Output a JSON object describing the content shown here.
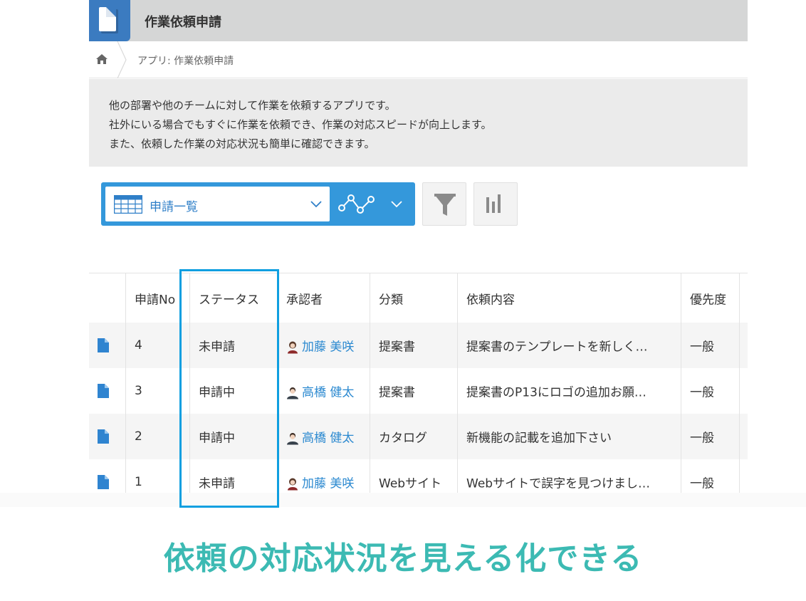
{
  "app": {
    "title": "作業依頼申請",
    "breadcrumb": "アプリ: 作業依頼申請",
    "description": [
      "他の部署や他のチームに対して作業を依頼するアプリです。",
      "社外にいる場合でもすぐに作業を依頼でき、作業の対応スピードが向上します。",
      "また、依頼した作業の対応状況も簡単に確認できます。"
    ]
  },
  "toolbar": {
    "view_label": "申請一覧"
  },
  "table": {
    "headers": [
      "申請No",
      "ステータス",
      "承認者",
      "分類",
      "依頼内容",
      "優先度"
    ],
    "rows": [
      {
        "no": "4",
        "status": "未申請",
        "approver": "加藤 美咲",
        "category": "提案書",
        "content": "提案書のテンプレートを新しく…",
        "priority": "一般"
      },
      {
        "no": "3",
        "status": "申請中",
        "approver": "高橋 健太",
        "category": "提案書",
        "content": "提案書のP13にロゴの追加お願…",
        "priority": "一般"
      },
      {
        "no": "2",
        "status": "申請中",
        "approver": "高橋 健太",
        "category": "カタログ",
        "content": "新機能の記載を追加下さい",
        "priority": "一般"
      },
      {
        "no": "1",
        "status": "未申請",
        "approver": "加藤 美咲",
        "category": "Webサイト",
        "content": "Webサイトで誤字を見つけまし…",
        "priority": "一般"
      }
    ]
  },
  "tagline": "依頼の対応状況を見える化できる",
  "colors": {
    "accent": "#3498db",
    "link": "#2b89d0",
    "highlight": "#0f9fe0",
    "tagline": "#3cbab3"
  }
}
